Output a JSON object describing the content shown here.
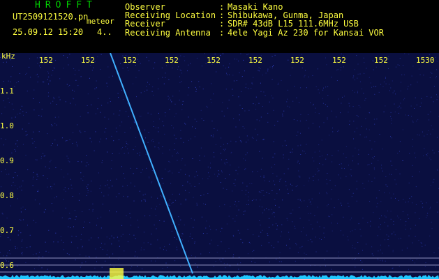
{
  "header": {
    "app_title": "HROFFT",
    "filename": "UT2509121520.pn",
    "mode": "meteor",
    "datetime": "25.09.12 15:20",
    "number": "4.."
  },
  "info": {
    "observer_key": "Observer",
    "observer_val": "Masaki Kano",
    "location_key": "Receiving Location",
    "location_val": "Shibukawa, Gunma, Japan",
    "receiver_key": "Receiver",
    "receiver_val": "SDR# 43dB L15 111.6MHz USB",
    "antenna_key": "Receiving Antenna",
    "antenna_val": "4ele Yagi Az 230 for Kansai VOR",
    "separator": ":"
  },
  "axis": {
    "unit": "kHz",
    "x_ticks": [
      "152",
      "152",
      "152",
      "152",
      "152",
      "152",
      "152",
      "152",
      "152",
      "1530"
    ],
    "y_ticks": [
      "1.1",
      "1.0",
      "0.9",
      "0.8",
      "0.7",
      "0.6"
    ]
  },
  "colors": {
    "background": "#0a0f40",
    "text": "#ffff40",
    "title": "#00d000",
    "trace": "#40b0ff",
    "noise": "#3040c0"
  }
}
